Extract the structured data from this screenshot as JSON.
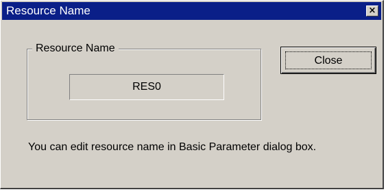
{
  "window": {
    "title": "Resource Name",
    "close_glyph": "×"
  },
  "group": {
    "label": "Resource Name",
    "value": "RES0"
  },
  "buttons": {
    "close_label": "Close"
  },
  "info_text": "You can edit resource name in Basic Parameter dialog box.",
  "colors": {
    "titlebar": "#0a1f88",
    "face": "#d4d0c8"
  },
  "icons": {
    "title_close": "close-icon"
  }
}
